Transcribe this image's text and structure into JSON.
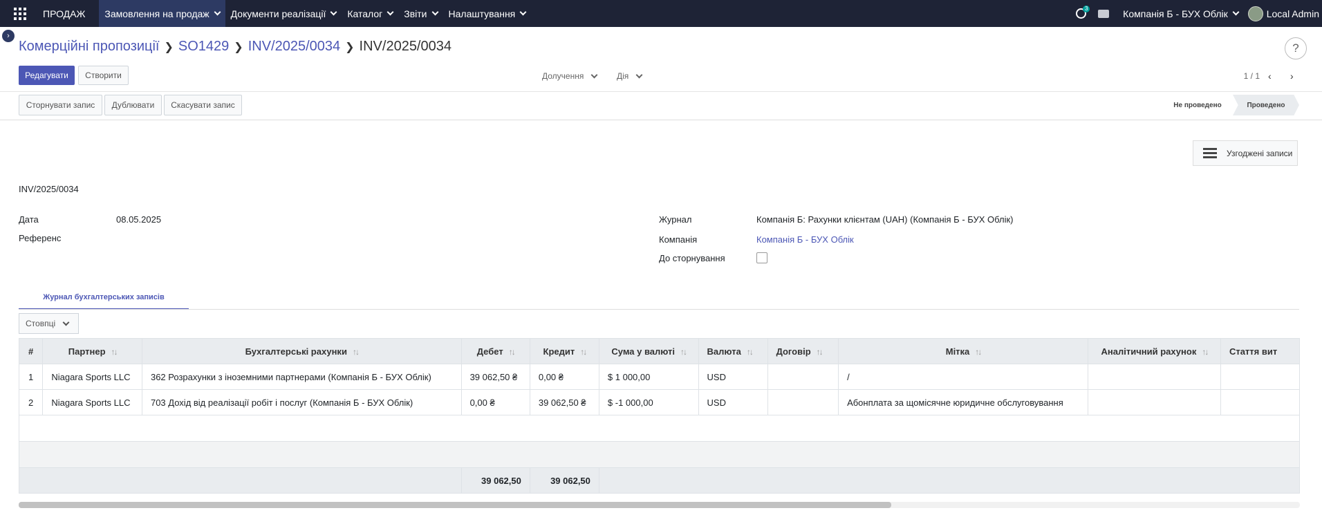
{
  "navbar": {
    "brand": "ПРОДАЖ",
    "menu": [
      {
        "label": "Замовлення на продаж"
      },
      {
        "label": "Документи реалізації"
      },
      {
        "label": "Каталог"
      },
      {
        "label": "Звіти"
      },
      {
        "label": "Налаштування"
      }
    ],
    "activity_count": "3",
    "company": "Компанія Б - БУХ Облік",
    "user": "Local Admin"
  },
  "breadcrumb": {
    "items": [
      "Комерційні пропозиції",
      "SO1429",
      "INV/2025/0034"
    ],
    "current": "INV/2025/0034"
  },
  "toolbar": {
    "edit": "Редагувати",
    "create": "Створити",
    "attach": "Долучення",
    "action": "Дія",
    "pager": "1 / 1"
  },
  "actions": {
    "reverse": "Сторнувати запис",
    "duplicate": "Дублювати",
    "cancel": "Скасувати запис"
  },
  "status": {
    "draft": "Не проведено",
    "posted": "Проведено"
  },
  "sheet": {
    "reconciled_button": "Узгоджені записи",
    "name": "INV/2025/0034",
    "date_label": "Дата",
    "date_value": "08.05.2025",
    "ref_label": "Референс",
    "journal_label": "Журнал",
    "journal_value": "Компанія Б: Рахунки клієнтам (UAH) (Компанія Б - БУХ Облік)",
    "company_label": "Компанія",
    "company_value": "Компанія Б - БУХ Облік",
    "to_reverse_label": "До сторнування",
    "tab": "Журнал бухгалтерських записів",
    "columns_button": "Стовпці"
  },
  "table": {
    "headers": {
      "num": "#",
      "partner": "Партнер",
      "account": "Бухгалтерські рахунки",
      "debit": "Дебет",
      "credit": "Кредит",
      "amount_currency": "Сума у валюті",
      "currency": "Валюта",
      "contract": "Договір",
      "label": "Мітка",
      "analytic": "Аналітичний рахунок",
      "expense": "Стаття вит"
    },
    "rows": [
      {
        "num": "1",
        "partner": "Niagara Sports LLC",
        "account": "362 Розрахунки з іноземними партнерами (Компанія Б - БУХ Облік)",
        "debit": "39 062,50 ₴",
        "credit": "0,00 ₴",
        "amount_currency": "$ 1 000,00",
        "currency": "USD",
        "contract": "",
        "label": "/",
        "analytic": "",
        "expense": ""
      },
      {
        "num": "2",
        "partner": "Niagara Sports LLC",
        "account": "703 Дохід від реалізації робіт і послуг (Компанія Б - БУХ Облік)",
        "debit": "0,00 ₴",
        "credit": "39 062,50 ₴",
        "amount_currency": "$ -1 000,00",
        "currency": "USD",
        "contract": "",
        "label": "Абонплата за щомісячне юридичне обслуговування",
        "analytic": "",
        "expense": ""
      }
    ],
    "totals": {
      "debit": "39 062,50",
      "credit": "39 062,50"
    }
  }
}
